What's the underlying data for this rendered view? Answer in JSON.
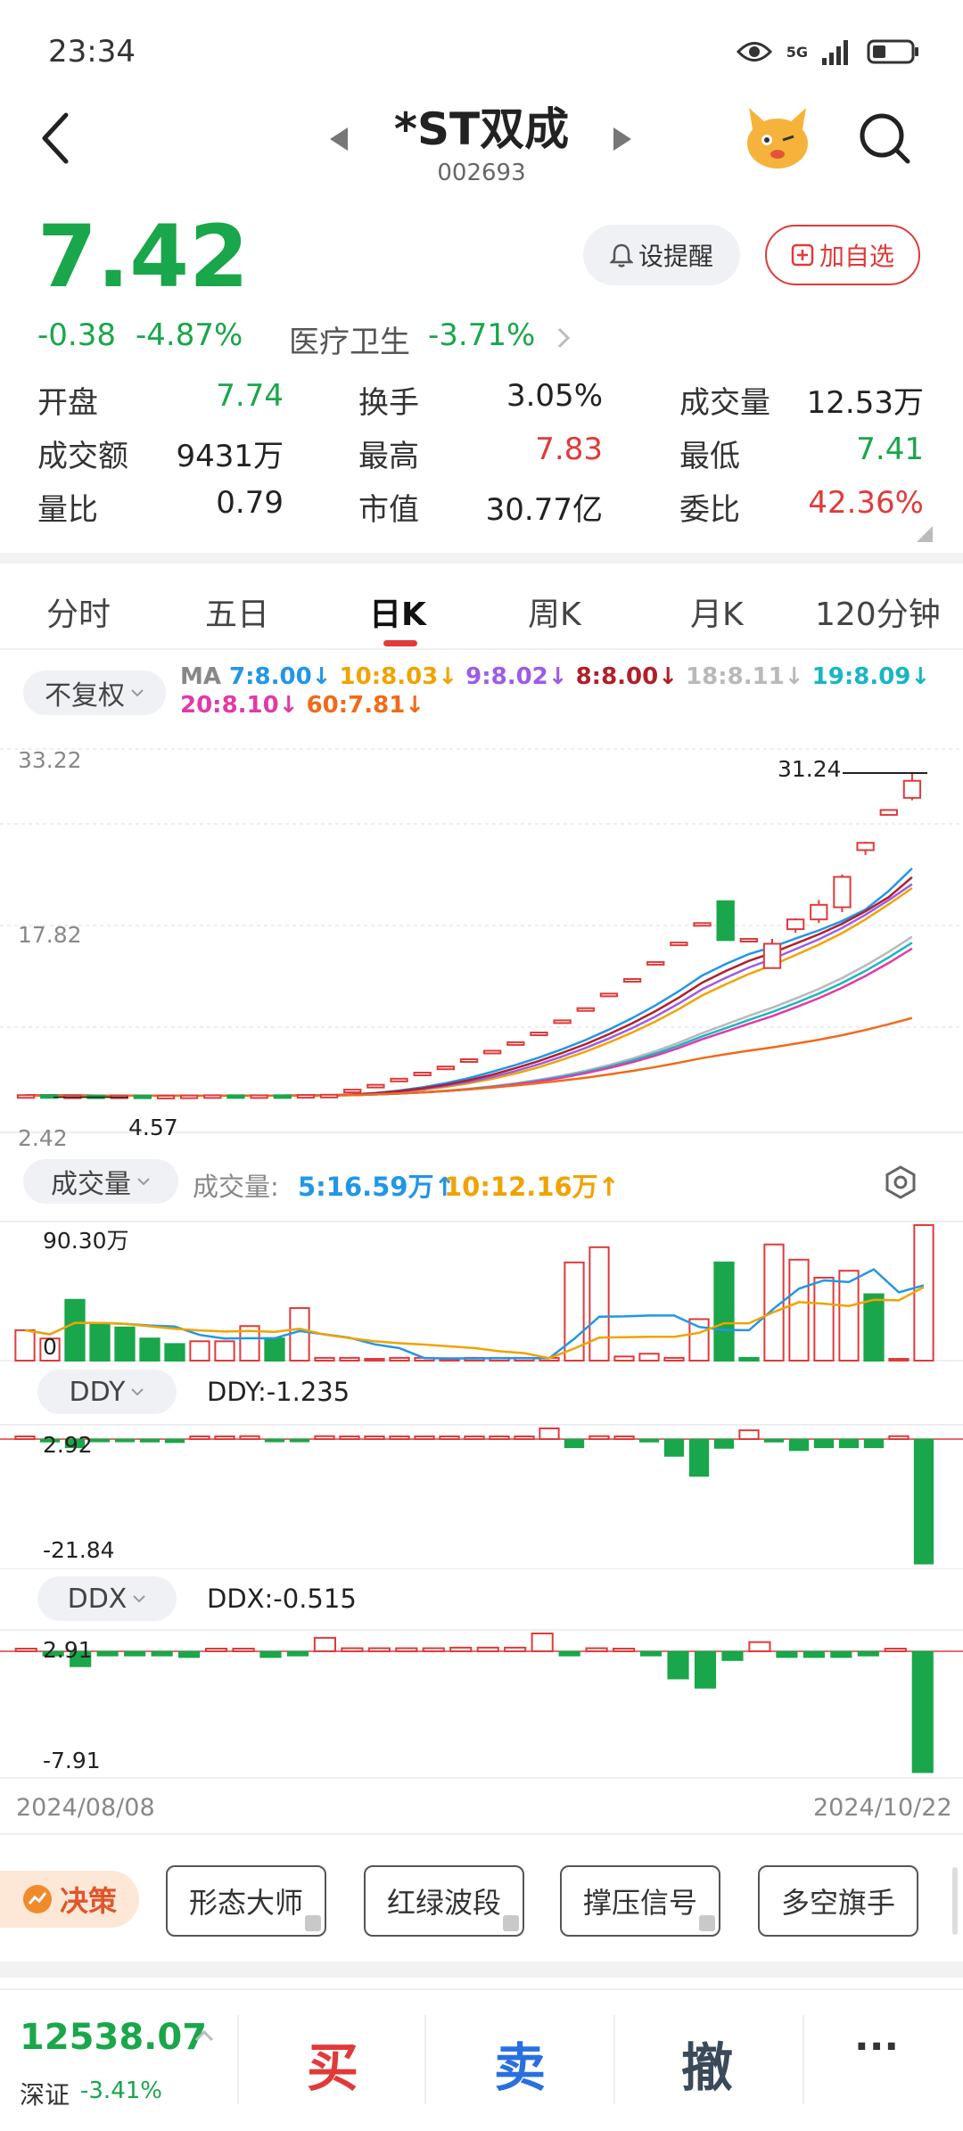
{
  "status": {
    "time": "23:34",
    "network": "5G"
  },
  "header": {
    "title": "*ST双成",
    "code": "002693"
  },
  "quote": {
    "price": "7.42",
    "change": "-0.38",
    "change_pct": "-4.87%",
    "sector": "医疗卫生",
    "sector_pct": "-3.71%",
    "alert_label": "设提醒",
    "watch_label": "加自选"
  },
  "stats": [
    {
      "label": "开盘",
      "value": "7.74",
      "color": "#1aa64a"
    },
    {
      "label": "换手",
      "value": "3.05%",
      "color": "#222222"
    },
    {
      "label": "成交量",
      "value": "12.53万",
      "color": "#222222"
    },
    {
      "label": "成交额",
      "value": "9431万",
      "color": "#222222"
    },
    {
      "label": "最高",
      "value": "7.83",
      "color": "#e03a3a"
    },
    {
      "label": "最低",
      "value": "7.41",
      "color": "#1aa64a"
    },
    {
      "label": "量比",
      "value": "0.79",
      "color": "#222222"
    },
    {
      "label": "市值",
      "value": "30.77亿",
      "color": "#222222"
    },
    {
      "label": "委比",
      "value": "42.36%",
      "color": "#e03a3a"
    }
  ],
  "tabs": [
    "分时",
    "五日",
    "日K",
    "周K",
    "月K",
    "120分钟"
  ],
  "active_tab": "日K",
  "chart": {
    "adjust_label": "不复权",
    "ma_prefix": "MA",
    "ma": [
      {
        "text": "7:8.00↓",
        "color": "#2196e8"
      },
      {
        "text": "10:8.03↓",
        "color": "#f0a300"
      },
      {
        "text": "9:8.02↓",
        "color": "#9c5ce6"
      },
      {
        "text": "8:8.00↓",
        "color": "#b0202a"
      },
      {
        "text": "18:8.11↓",
        "color": "#b9b9b9"
      },
      {
        "text": "19:8.09↓",
        "color": "#17b6c6"
      },
      {
        "text": "20:8.10↓",
        "color": "#e03aa8"
      },
      {
        "text": "60:7.81↓",
        "color": "#f06a1a"
      }
    ],
    "price_axis": {
      "top": "33.22",
      "mid": "17.82",
      "bottom": "2.42"
    },
    "high_label": "31.24",
    "low_label": "4.57",
    "volume_label": "成交量",
    "volume_prefix": "成交量:",
    "vol_ma5": "5:16.59万↑",
    "vol_ma10": "10:12.16万↑",
    "volume_top": "90.30万",
    "volume_zero": "0",
    "ddy_label": "DDY",
    "ddy_value": "DDY:-1.235",
    "ddy_top": "2.92",
    "ddy_bottom": "-21.84",
    "ddx_label": "DDX",
    "ddx_value": "DDX:-0.515",
    "ddx_top": "2.91",
    "ddx_bottom": "-7.91",
    "date_start": "2024/08/08",
    "date_end": "2024/10/22"
  },
  "tools": {
    "decision": "决策",
    "items": [
      "形态大师",
      "红绿波段",
      "撑压信号",
      "多空旗手"
    ]
  },
  "trade": {
    "index_value": "12538.07",
    "index_name": "深证",
    "index_pct": "-3.41%",
    "buy": "买",
    "sell": "卖",
    "cancel": "撤",
    "more": "···"
  },
  "chart_data": {
    "type": "candlestick",
    "x_range": [
      "2024/08/08",
      "2024/10/22"
    ],
    "ylim": [
      2.42,
      33.22
    ],
    "candles": [
      {
        "o": 4.7,
        "c": 4.75,
        "h": 4.8,
        "l": 4.6,
        "up": true
      },
      {
        "o": 4.75,
        "c": 4.7,
        "h": 4.8,
        "l": 4.6,
        "up": false
      },
      {
        "o": 4.7,
        "c": 4.72,
        "h": 4.8,
        "l": 4.6,
        "up": true
      },
      {
        "o": 4.72,
        "c": 4.7,
        "h": 4.78,
        "l": 4.62,
        "up": false
      },
      {
        "o": 4.7,
        "c": 4.72,
        "h": 4.76,
        "l": 4.64,
        "up": true
      },
      {
        "o": 4.72,
        "c": 4.68,
        "h": 4.76,
        "l": 4.64,
        "up": false
      },
      {
        "o": 4.68,
        "c": 4.7,
        "h": 4.74,
        "l": 4.62,
        "up": true
      },
      {
        "o": 4.7,
        "c": 4.72,
        "h": 4.75,
        "l": 4.65,
        "up": true
      },
      {
        "o": 4.72,
        "c": 4.74,
        "h": 4.78,
        "l": 4.68,
        "up": true
      },
      {
        "o": 4.74,
        "c": 4.72,
        "h": 4.78,
        "l": 4.68,
        "up": false
      },
      {
        "o": 4.72,
        "c": 4.74,
        "h": 4.78,
        "l": 4.7,
        "up": true
      },
      {
        "o": 4.74,
        "c": 4.7,
        "h": 4.78,
        "l": 4.68,
        "up": false
      },
      {
        "o": 4.7,
        "c": 4.76,
        "h": 4.8,
        "l": 4.68,
        "up": true
      },
      {
        "o": 4.76,
        "c": 4.78,
        "h": 4.82,
        "l": 4.72,
        "up": true
      },
      {
        "o": 5.1,
        "c": 5.2,
        "h": 5.2,
        "l": 5.1,
        "up": true
      },
      {
        "o": 5.5,
        "c": 5.6,
        "h": 5.6,
        "l": 5.5,
        "up": true
      },
      {
        "o": 6.0,
        "c": 6.1,
        "h": 6.1,
        "l": 6.0,
        "up": true
      },
      {
        "o": 6.5,
        "c": 6.6,
        "h": 6.6,
        "l": 6.5,
        "up": true
      },
      {
        "o": 7.0,
        "c": 7.1,
        "h": 7.1,
        "l": 7.0,
        "up": true
      },
      {
        "o": 7.6,
        "c": 7.7,
        "h": 7.7,
        "l": 7.6,
        "up": true
      },
      {
        "o": 8.3,
        "c": 8.4,
        "h": 8.4,
        "l": 8.3,
        "up": true
      },
      {
        "o": 9.0,
        "c": 9.1,
        "h": 9.1,
        "l": 9.0,
        "up": true
      },
      {
        "o": 9.8,
        "c": 9.9,
        "h": 9.9,
        "l": 9.8,
        "up": true
      },
      {
        "o": 10.8,
        "c": 10.9,
        "h": 10.9,
        "l": 10.8,
        "up": true
      },
      {
        "o": 11.8,
        "c": 11.9,
        "h": 11.9,
        "l": 11.8,
        "up": true
      },
      {
        "o": 13.0,
        "c": 13.1,
        "h": 13.1,
        "l": 13.0,
        "up": true
      },
      {
        "o": 14.2,
        "c": 14.3,
        "h": 14.3,
        "l": 14.2,
        "up": true
      },
      {
        "o": 15.6,
        "c": 15.7,
        "h": 15.7,
        "l": 15.6,
        "up": true
      },
      {
        "o": 17.2,
        "c": 17.3,
        "h": 17.3,
        "l": 17.2,
        "up": true
      },
      {
        "o": 18.8,
        "c": 18.9,
        "h": 18.9,
        "l": 18.8,
        "up": true
      },
      {
        "o": 20.7,
        "c": 17.5,
        "h": 20.7,
        "l": 17.5,
        "up": false
      },
      {
        "o": 17.5,
        "c": 17.6,
        "h": 17.6,
        "l": 17.5,
        "up": true
      },
      {
        "o": 15.2,
        "c": 17.2,
        "h": 17.6,
        "l": 15.2,
        "up": true
      },
      {
        "o": 18.4,
        "c": 19.2,
        "h": 19.3,
        "l": 18.1,
        "up": true
      },
      {
        "o": 19.2,
        "c": 20.4,
        "h": 20.8,
        "l": 18.9,
        "up": true
      },
      {
        "o": 20.2,
        "c": 22.7,
        "h": 22.9,
        "l": 19.8,
        "up": true
      },
      {
        "o": 24.9,
        "c": 25.5,
        "h": 25.6,
        "l": 24.5,
        "up": true
      },
      {
        "o": 27.8,
        "c": 28.2,
        "h": 28.2,
        "l": 27.8,
        "up": true
      },
      {
        "o": 29.2,
        "c": 30.6,
        "h": 31.24,
        "l": 29.0,
        "up": true
      }
    ],
    "volume": [
      {
        "v": 22,
        "up": true
      },
      {
        "v": 16,
        "up": true
      },
      {
        "v": 44,
        "up": false
      },
      {
        "v": 27,
        "up": false
      },
      {
        "v": 24,
        "up": false
      },
      {
        "v": 16,
        "up": false
      },
      {
        "v": 12,
        "up": false
      },
      {
        "v": 14,
        "up": true
      },
      {
        "v": 14,
        "up": true
      },
      {
        "v": 25,
        "up": true
      },
      {
        "v": 16,
        "up": false
      },
      {
        "v": 38,
        "up": true
      },
      {
        "v": 2,
        "up": true
      },
      {
        "v": 2,
        "up": true
      },
      {
        "v": 1,
        "up": true
      },
      {
        "v": 2,
        "up": true
      },
      {
        "v": 2,
        "up": true
      },
      {
        "v": 1,
        "up": true
      },
      {
        "v": 2,
        "up": true
      },
      {
        "v": 2,
        "up": true
      },
      {
        "v": 2,
        "up": true
      },
      {
        "v": 2,
        "up": true
      },
      {
        "v": 71,
        "up": true
      },
      {
        "v": 82,
        "up": true
      },
      {
        "v": 3,
        "up": true
      },
      {
        "v": 5,
        "up": true
      },
      {
        "v": 2,
        "up": true
      },
      {
        "v": 30,
        "up": true
      },
      {
        "v": 71,
        "up": false
      },
      {
        "v": 2,
        "up": false
      },
      {
        "v": 84,
        "up": true
      },
      {
        "v": 73,
        "up": true
      },
      {
        "v": 60,
        "up": true
      },
      {
        "v": 65,
        "up": true
      },
      {
        "v": 48,
        "up": false
      },
      {
        "v": 1,
        "up": true
      },
      {
        "v": 98,
        "up": true
      }
    ],
    "ddy": [
      0.5,
      -0.5,
      -1.5,
      -0.4,
      -0.4,
      -0.5,
      -0.6,
      0.4,
      0.5,
      0.8,
      -0.4,
      -0.4,
      0.8,
      0.6,
      0.6,
      0.6,
      0.6,
      0.6,
      0.6,
      0.6,
      0.6,
      2.92,
      -1.5,
      0.8,
      0.6,
      -0.5,
      -3.0,
      -6.5,
      -1.6,
      2.4,
      -0.5,
      -2.0,
      -1.5,
      -1.5,
      -1.5,
      0.8,
      -21.84
    ],
    "ddx": [
      0.3,
      -0.3,
      -1.0,
      -0.3,
      -0.3,
      -0.3,
      -0.4,
      0.3,
      0.4,
      -0.4,
      -0.3,
      2.2,
      0.5,
      0.5,
      0.5,
      0.5,
      0.6,
      0.6,
      0.6,
      2.91,
      -0.3,
      0.5,
      0.4,
      -0.3,
      -1.8,
      -2.4,
      -0.6,
      1.5,
      -0.4,
      -0.4,
      -0.4,
      -0.3,
      0.3,
      -7.91
    ]
  }
}
